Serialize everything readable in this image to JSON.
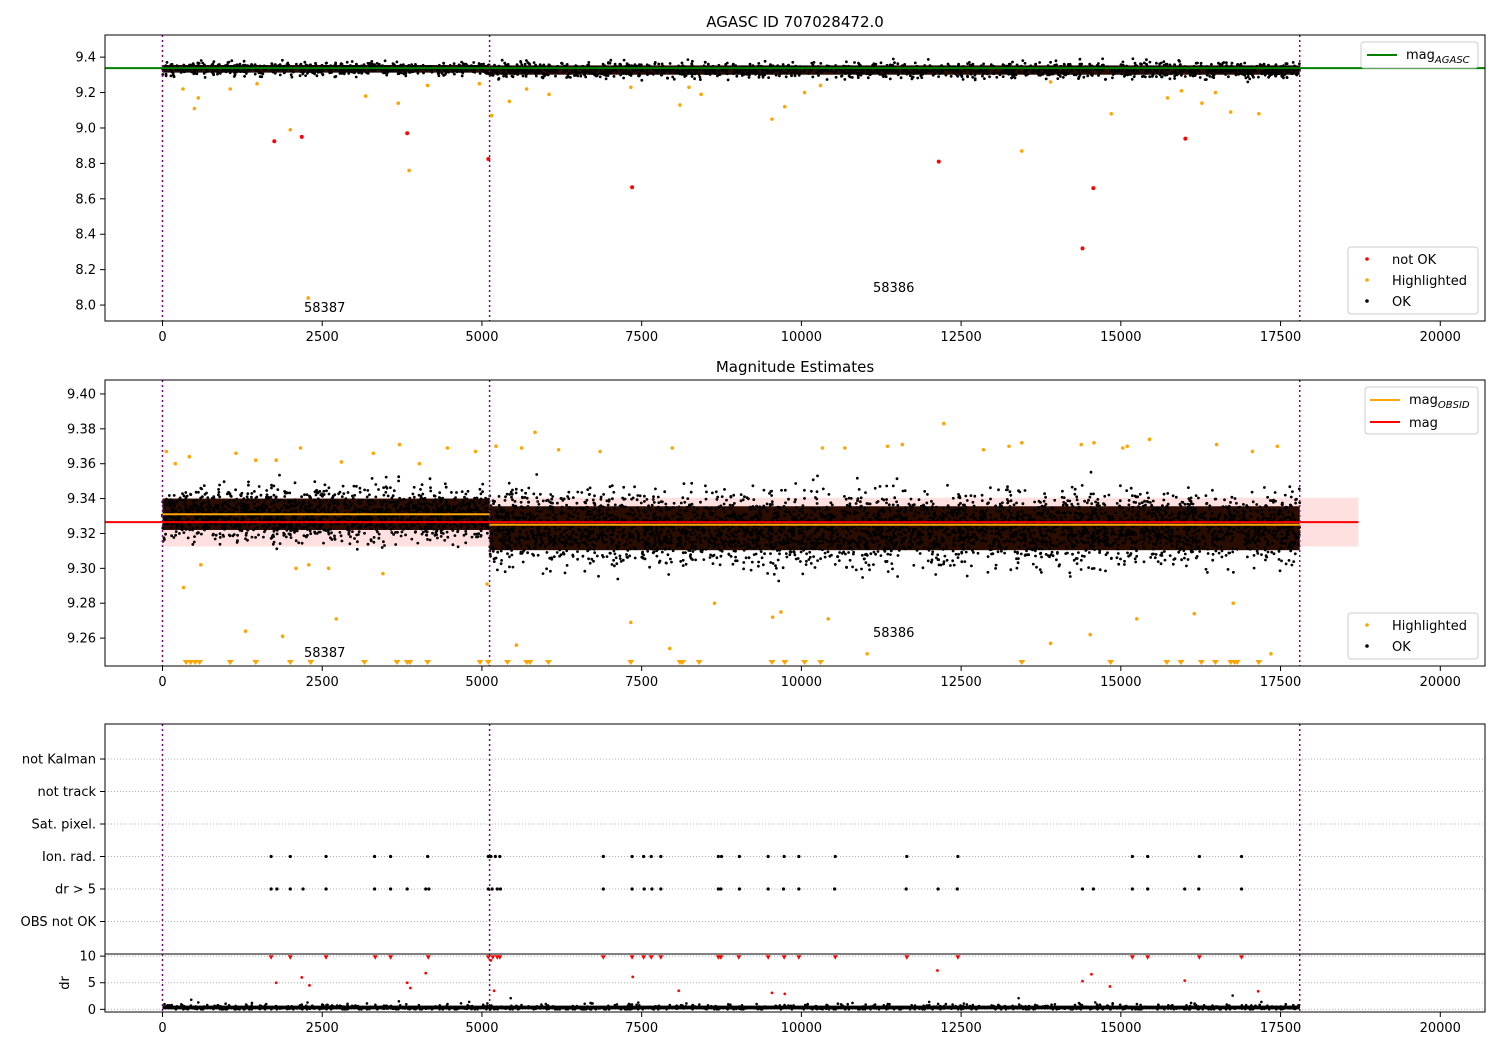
{
  "chart_data": [
    {
      "type": "scatter",
      "title": "AGASC ID 707028472.0",
      "xlim": [
        -900,
        20700
      ],
      "ylim": [
        7.91,
        9.525
      ],
      "x_ticks": [
        0,
        2500,
        5000,
        7500,
        10000,
        12500,
        15000,
        17500,
        20000
      ],
      "x_tick_labels": [
        "0",
        "2500",
        "5000",
        "7500",
        "10000",
        "12500",
        "15000",
        "17500",
        "20000"
      ],
      "y_ticks": [
        8.0,
        8.2,
        8.4,
        8.6,
        8.8,
        9.0,
        9.2,
        9.4
      ],
      "y_tick_labels": [
        "8.0",
        "8.2",
        "8.4",
        "8.6",
        "8.8",
        "9.0",
        "9.2",
        "9.4"
      ],
      "obsid_boundaries": [
        0,
        5120,
        17800
      ],
      "obsid_labels": [
        {
          "text": "58387",
          "x": 2550,
          "y": 7.99
        },
        {
          "text": "58386",
          "x": 11450,
          "y": 8.09
        }
      ],
      "mag_agasc": 9.338,
      "legend_upper": {
        "position": "upper-right",
        "entries": [
          "mag",
          "AGASC"
        ]
      },
      "legend_lower": {
        "position": "lower-right",
        "entries": [
          "not OK",
          "Highlighted",
          "OK"
        ]
      },
      "ok_band": {
        "segments": [
          [
            0,
            5120,
            9.334,
            0.018
          ],
          [
            5120,
            17800,
            9.327,
            0.022
          ]
        ]
      },
      "not_ok_points": [
        [
          1750,
          8.925
        ],
        [
          2180,
          8.95
        ],
        [
          3830,
          8.97
        ],
        [
          5100,
          8.825
        ],
        [
          7350,
          8.665
        ],
        [
          12150,
          8.81
        ],
        [
          14400,
          8.32
        ],
        [
          14570,
          8.66
        ],
        [
          16010,
          8.94
        ]
      ],
      "highlighted_points": [
        [
          320,
          9.22
        ],
        [
          500,
          9.11
        ],
        [
          560,
          9.17
        ],
        [
          1060,
          9.22
        ],
        [
          1480,
          9.25
        ],
        [
          2000,
          8.99
        ],
        [
          2280,
          8.04
        ],
        [
          3180,
          9.18
        ],
        [
          3690,
          9.14
        ],
        [
          3860,
          8.76
        ],
        [
          4150,
          9.24
        ],
        [
          4960,
          9.25
        ],
        [
          5150,
          9.07
        ],
        [
          5430,
          9.15
        ],
        [
          5700,
          9.22
        ],
        [
          6050,
          9.19
        ],
        [
          7330,
          9.23
        ],
        [
          8100,
          9.13
        ],
        [
          8240,
          9.23
        ],
        [
          8430,
          9.19
        ],
        [
          9540,
          9.05
        ],
        [
          9740,
          9.12
        ],
        [
          10050,
          9.2
        ],
        [
          10300,
          9.24
        ],
        [
          13450,
          8.87
        ],
        [
          13900,
          9.26
        ],
        [
          14850,
          9.08
        ],
        [
          15730,
          9.17
        ],
        [
          15950,
          9.21
        ],
        [
          16270,
          9.14
        ],
        [
          16480,
          9.2
        ],
        [
          16720,
          9.09
        ],
        [
          17160,
          9.08
        ]
      ]
    },
    {
      "type": "scatter",
      "title": "Magnitude Estimates",
      "xlim": [
        -900,
        20700
      ],
      "ylim": [
        9.244,
        9.408
      ],
      "x_ticks": [
        0,
        2500,
        5000,
        7500,
        10000,
        12500,
        15000,
        17500,
        20000
      ],
      "x_tick_labels": [
        "0",
        "2500",
        "5000",
        "7500",
        "10000",
        "12500",
        "15000",
        "17500",
        "20000"
      ],
      "y_ticks": [
        9.26,
        9.28,
        9.3,
        9.32,
        9.34,
        9.36,
        9.38,
        9.4
      ],
      "y_tick_labels": [
        "9.26",
        "9.28",
        "9.30",
        "9.32",
        "9.34",
        "9.36",
        "9.38",
        "9.40"
      ],
      "obsid_boundaries": [
        0,
        5120,
        17800
      ],
      "obsid_labels": [
        {
          "text": "58387",
          "x": 2550,
          "y": 9.248
        },
        {
          "text": "58386",
          "x": 11450,
          "y": 9.26
        }
      ],
      "mag": 9.3265,
      "mag_band": [
        9.3125,
        9.3405
      ],
      "mag_obsid": [
        [
          0,
          5120,
          9.331
        ],
        [
          5120,
          17800,
          9.325
        ]
      ],
      "legend_upper": {
        "position": "upper-right",
        "entries": [
          "mag",
          "OBSID",
          "mag"
        ]
      },
      "legend_lower": {
        "position": "lower-right",
        "entries": [
          "Highlighted",
          "OK"
        ]
      },
      "ok_band": {
        "segments": [
          [
            0,
            5120,
            9.331,
            0.0075
          ],
          [
            5120,
            17800,
            9.323,
            0.0105
          ]
        ]
      },
      "highlighted_points": [
        [
          60,
          9.367
        ],
        [
          200,
          9.36
        ],
        [
          330,
          9.289
        ],
        [
          420,
          9.364
        ],
        [
          600,
          9.302
        ],
        [
          1150,
          9.366
        ],
        [
          1300,
          9.264
        ],
        [
          1460,
          9.362
        ],
        [
          1780,
          9.362
        ],
        [
          1880,
          9.261
        ],
        [
          2090,
          9.3
        ],
        [
          2160,
          9.369
        ],
        [
          2290,
          9.302
        ],
        [
          2600,
          9.3
        ],
        [
          2720,
          9.271
        ],
        [
          2800,
          9.361
        ],
        [
          3300,
          9.366
        ],
        [
          3450,
          9.297
        ],
        [
          3710,
          9.371
        ],
        [
          4020,
          9.36
        ],
        [
          4460,
          9.369
        ],
        [
          4900,
          9.367
        ],
        [
          5080,
          9.291
        ],
        [
          5220,
          9.37
        ],
        [
          5540,
          9.256
        ],
        [
          5620,
          9.369
        ],
        [
          5830,
          9.378
        ],
        [
          6200,
          9.368
        ],
        [
          6850,
          9.367
        ],
        [
          7330,
          9.269
        ],
        [
          7980,
          9.369
        ],
        [
          7940,
          9.254
        ],
        [
          8640,
          9.28
        ],
        [
          9550,
          9.272
        ],
        [
          9680,
          9.275
        ],
        [
          10330,
          9.369
        ],
        [
          10420,
          9.271
        ],
        [
          10680,
          9.369
        ],
        [
          11030,
          9.251
        ],
        [
          11350,
          9.37
        ],
        [
          11580,
          9.371
        ],
        [
          12230,
          9.383
        ],
        [
          12850,
          9.368
        ],
        [
          13250,
          9.37
        ],
        [
          13450,
          9.372
        ],
        [
          13900,
          9.257
        ],
        [
          14380,
          9.371
        ],
        [
          14520,
          9.262
        ],
        [
          14580,
          9.372
        ],
        [
          15030,
          9.369
        ],
        [
          15100,
          9.37
        ],
        [
          15250,
          9.271
        ],
        [
          15450,
          9.374
        ],
        [
          16150,
          9.274
        ],
        [
          16500,
          9.371
        ],
        [
          16760,
          9.28
        ],
        [
          17060,
          9.367
        ],
        [
          17350,
          9.251
        ],
        [
          17450,
          9.37
        ]
      ],
      "lower_limit_markers": [
        370,
        440,
        510,
        580,
        1060,
        1460,
        2000,
        2320,
        3160,
        3670,
        3830,
        3870,
        4150,
        4970,
        5100,
        5400,
        5700,
        5750,
        6040,
        7330,
        8100,
        8140,
        8400,
        9540,
        9740,
        10050,
        10300,
        13450,
        14840,
        15720,
        15940,
        16260,
        16480,
        16720,
        16780,
        16820,
        17160
      ]
    },
    {
      "type": "scatter",
      "title": "",
      "xlim": [
        -900,
        20700
      ],
      "categories": [
        "not Kalman",
        "not track",
        "Sat. pixel.",
        "Ion. rad.",
        "dr > 5",
        "OBS not OK"
      ],
      "obsid_boundaries": [
        0,
        5120,
        17800
      ],
      "flag_points": {
        "Ion. rad.": [
          1700,
          2000,
          2560,
          3320,
          3570,
          4150,
          5100,
          5140,
          5210,
          5280,
          6900,
          7350,
          7530,
          7650,
          7800,
          8700,
          8750,
          9030,
          9480,
          9730,
          9960,
          10530,
          11650,
          12450,
          15180,
          15420,
          16230,
          16890
        ],
        "dr > 5": [
          1700,
          1790,
          2000,
          2200,
          2560,
          3320,
          3570,
          3830,
          4120,
          4170,
          5100,
          5160,
          5240,
          5290,
          6900,
          7350,
          7540,
          7660,
          7800,
          8700,
          8740,
          9030,
          9480,
          9720,
          9960,
          10520,
          11640,
          12140,
          12440,
          14400,
          14570,
          15180,
          15420,
          16000,
          16220,
          16890
        ]
      }
    },
    {
      "type": "scatter",
      "title": "",
      "ylabel": "dr",
      "xlim": [
        -900,
        20700
      ],
      "ylim": [
        -0.5,
        10.4
      ],
      "y_ticks": [
        0,
        5,
        10
      ],
      "y_tick_labels": [
        "0",
        "5",
        "10"
      ],
      "x_ticks": [
        0,
        2500,
        5000,
        7500,
        10000,
        12500,
        15000,
        17500,
        20000
      ],
      "x_tick_labels": [
        "0",
        "2500",
        "5000",
        "7500",
        "10000",
        "12500",
        "15000",
        "17500",
        "20000"
      ],
      "obsid_boundaries": [
        0,
        5120,
        17800
      ],
      "ok_band": [
        0,
        17800,
        0.35,
        0.35
      ],
      "red_points": [
        [
          1700,
          9.8
        ],
        [
          1780,
          5.0
        ],
        [
          2000,
          9.8
        ],
        [
          2180,
          6.0
        ],
        [
          2300,
          4.5
        ],
        [
          2560,
          9.8
        ],
        [
          3330,
          9.8
        ],
        [
          3570,
          9.8
        ],
        [
          3830,
          5.0
        ],
        [
          3880,
          4.0
        ],
        [
          4120,
          6.8
        ],
        [
          4160,
          9.8
        ],
        [
          5100,
          9.8
        ],
        [
          5140,
          9.2
        ],
        [
          5170,
          9.8
        ],
        [
          5190,
          3.5
        ],
        [
          5240,
          9.8
        ],
        [
          5280,
          9.8
        ],
        [
          6900,
          9.8
        ],
        [
          7350,
          9.8
        ],
        [
          7360,
          6.1
        ],
        [
          7530,
          9.8
        ],
        [
          7650,
          9.8
        ],
        [
          7800,
          9.8
        ],
        [
          8080,
          3.5
        ],
        [
          8700,
          9.8
        ],
        [
          8740,
          9.8
        ],
        [
          9020,
          9.8
        ],
        [
          9480,
          9.8
        ],
        [
          9540,
          3.1
        ],
        [
          9730,
          9.8
        ],
        [
          9740,
          2.9
        ],
        [
          9960,
          9.8
        ],
        [
          10530,
          9.8
        ],
        [
          11650,
          9.8
        ],
        [
          12130,
          7.3
        ],
        [
          12450,
          9.8
        ],
        [
          14400,
          5.3
        ],
        [
          14540,
          6.6
        ],
        [
          14830,
          4.3
        ],
        [
          15180,
          9.8
        ],
        [
          15420,
          9.8
        ],
        [
          16000,
          5.4
        ],
        [
          16230,
          9.8
        ],
        [
          16890,
          9.8
        ],
        [
          17150,
          3.4
        ]
      ],
      "scattered_ok_points": [
        [
          450,
          1.8
        ],
        [
          560,
          1.3
        ],
        [
          1400,
          1.2
        ],
        [
          2500,
          0.9
        ],
        [
          3200,
          1.1
        ],
        [
          3700,
          1.5
        ],
        [
          4800,
          1.4
        ],
        [
          5450,
          2.1
        ],
        [
          6000,
          1.0
        ],
        [
          6700,
          1.2
        ],
        [
          8200,
          1.1
        ],
        [
          9300,
          1.0
        ],
        [
          10800,
          1.2
        ],
        [
          12000,
          1.4
        ],
        [
          13400,
          2.1
        ],
        [
          14600,
          1.3
        ],
        [
          16100,
          1.2
        ],
        [
          16750,
          2.6
        ],
        [
          17200,
          1.4
        ]
      ]
    }
  ]
}
